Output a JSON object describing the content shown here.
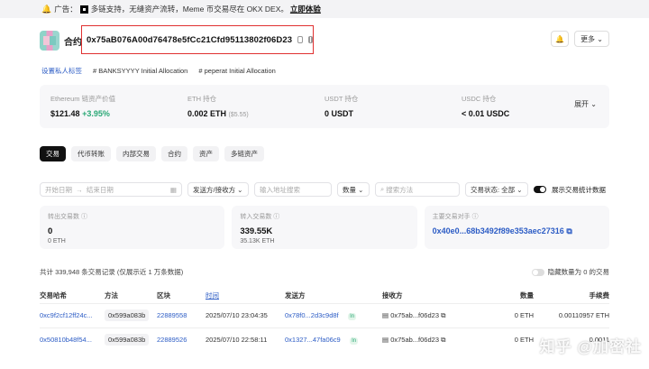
{
  "banner": {
    "prefix": "广告：",
    "text": "多链支持，无缝资产流转，Meme 币交易尽在 OKX DEX。",
    "cta": "立即体验"
  },
  "header": {
    "label": "合约",
    "address": "0x75aB076A00d76478e5fCc21Cfd95113802f06D23",
    "more": "更多"
  },
  "tags": {
    "set_label": "设置私人标签",
    "tag1": "# BANKSYYYY Initial Allocation",
    "tag2": "# peperat Initial Allocation"
  },
  "balances": [
    {
      "label": "Ethereum 链资产价值",
      "value": "$121.48",
      "change": "+3.95%",
      "sub": ""
    },
    {
      "label": "ETH 持仓",
      "value": "0.002 ETH",
      "change": "",
      "sub": "($5.55)"
    },
    {
      "label": "USDT 持仓",
      "value": "0 USDT",
      "change": "",
      "sub": ""
    },
    {
      "label": "USDC 持仓",
      "value": "< 0.01 USDC",
      "change": "",
      "sub": ""
    }
  ],
  "expand_label": "展开",
  "tabs": [
    "交易",
    "代币转账",
    "内部交易",
    "合约",
    "资产",
    "多链资产"
  ],
  "filters": {
    "start_date": "开始日期",
    "end_date": "结束日期",
    "direction": "发送方/接收方",
    "address_placeholder": "输入地址搜索",
    "quantity": "数量",
    "method_placeholder": "搜索方法",
    "status": "交易状态: 全部",
    "show_stats": "展示交易统计数据"
  },
  "stats": [
    {
      "label": "转出交易数",
      "value": "0",
      "sub": "0 ETH"
    },
    {
      "label": "转入交易数",
      "value": "339.55K",
      "sub": "35.13K ETH"
    },
    {
      "label": "主要交易对手",
      "value": "0x40e0...68b3492f89e353aec27316",
      "sub": ""
    }
  ],
  "summary": {
    "text": "共计 339,948 条交易记录 (仅展示近 1 万条数据)",
    "hide_zero": "隐藏数量为 0 的交易"
  },
  "table": {
    "headers": [
      "交易哈希",
      "方法",
      "区块",
      "时间",
      "发送方",
      "接收方",
      "数量",
      "手续费"
    ],
    "rows": [
      {
        "hash": "0xc9f2cf12ff24c...",
        "method": "0x599a083b",
        "block": "22889558",
        "time": "2025/07/10 23:04:35",
        "from": "0x78f0...2d3c9d8f",
        "dir": "In",
        "to": "0x75ab...f06d23",
        "amount": "0 ETH",
        "fee": "0.00110957 ETH"
      },
      {
        "hash": "0x50810b48f54...",
        "method": "0x599a083b",
        "block": "22889526",
        "time": "2025/07/10 22:58:11",
        "from": "0x1327...47fa06c9",
        "dir": "In",
        "to": "0x75ab...f06d23",
        "amount": "0 ETH",
        "fee": "0.0011"
      }
    ]
  },
  "watermark": "知乎 @加密社"
}
